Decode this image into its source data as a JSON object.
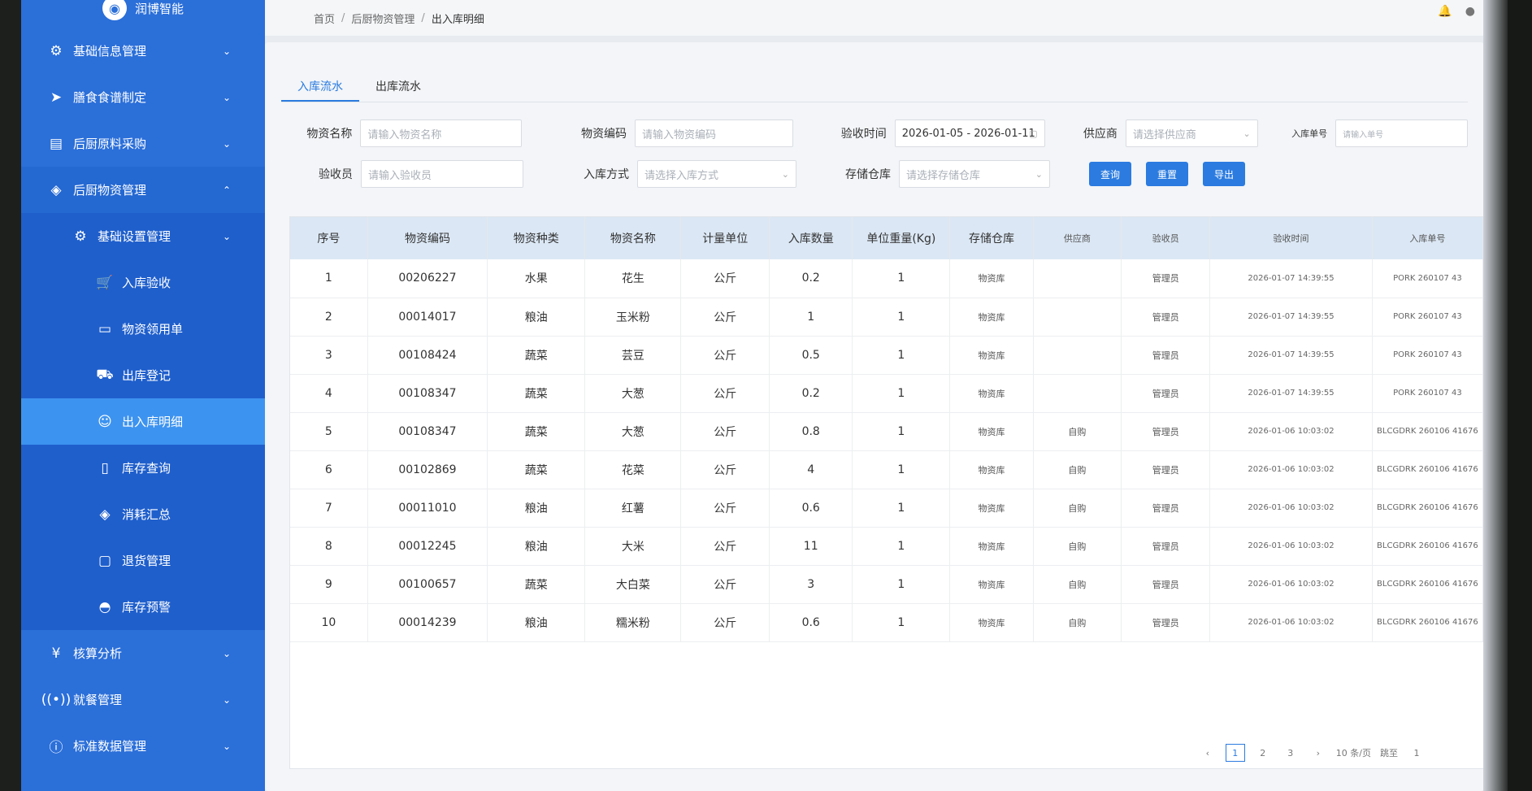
{
  "logo": {
    "text": "润博智能"
  },
  "sidebar": {
    "items": [
      {
        "label": "基础信息管理",
        "icon": "gear-icon"
      },
      {
        "label": "膳食食谱制定",
        "icon": "send-icon"
      },
      {
        "label": "后厨原料采购",
        "icon": "clipboard-icon"
      },
      {
        "label": "后厨物资管理",
        "icon": "layers-icon"
      }
    ],
    "sub": {
      "label": "基础设置管理"
    },
    "sub_items": [
      {
        "label": "入库验收",
        "icon": "cart-icon"
      },
      {
        "label": "物资领用单",
        "icon": "card-icon"
      },
      {
        "label": "出库登记",
        "icon": "truck-icon"
      },
      {
        "label": "出入库明细",
        "icon": "user-icon"
      },
      {
        "label": "库存查询",
        "icon": "document-icon"
      },
      {
        "label": "消耗汇总",
        "icon": "layers-icon"
      },
      {
        "label": "退货管理",
        "icon": "box-icon"
      },
      {
        "label": "库存预警",
        "icon": "eye-icon"
      }
    ],
    "bottom_items": [
      {
        "label": "核算分析",
        "icon": "yen-icon"
      },
      {
        "label": "就餐管理",
        "icon": "signal-icon"
      },
      {
        "label": "标准数据管理",
        "icon": "info-icon"
      }
    ]
  },
  "breadcrumb": {
    "home": "首页",
    "parent": "后厨物资管理",
    "current": "出入库明细"
  },
  "tabs": [
    "入库流水",
    "出库流水"
  ],
  "filters": {
    "name_label": "物资名称",
    "name_placeholder": "请输入物资名称",
    "code_label": "物资编码",
    "code_placeholder": "请输入物资编码",
    "time_label": "验收时间",
    "time_value": "2026-01-05 - 2026-01-11",
    "supplier_label": "供应商",
    "supplier_placeholder": "请选择供应商",
    "order_label": "入库单号",
    "order_placeholder": "请输入单号",
    "inspector_label": "验收员",
    "inspector_placeholder": "请输入验收员",
    "method_label": "入库方式",
    "method_placeholder": "请选择入库方式",
    "warehouse_label": "存储仓库",
    "warehouse_placeholder": "请选择存储仓库",
    "btn_query": "查询",
    "btn_reset": "重置",
    "btn_export": "导出"
  },
  "table": {
    "headers": [
      "序号",
      "物资编码",
      "物资种类",
      "物资名称",
      "计量单位",
      "入库数量",
      "单位重量(Kg)",
      "存储仓库",
      "供应商",
      "验收员",
      "验收时间",
      "入库单号"
    ],
    "rows": [
      [
        "1",
        "00206227",
        "水果",
        "花生",
        "公斤",
        "0.2",
        "1",
        "物资库",
        "",
        "管理员",
        "2026-01-07 14:39:55",
        "PORK 260107 43"
      ],
      [
        "2",
        "00014017",
        "粮油",
        "玉米粉",
        "公斤",
        "1",
        "1",
        "物资库",
        "",
        "管理员",
        "2026-01-07 14:39:55",
        "PORK 260107 43"
      ],
      [
        "3",
        "00108424",
        "蔬菜",
        "芸豆",
        "公斤",
        "0.5",
        "1",
        "物资库",
        "",
        "管理员",
        "2026-01-07 14:39:55",
        "PORK 260107 43"
      ],
      [
        "4",
        "00108347",
        "蔬菜",
        "大葱",
        "公斤",
        "0.2",
        "1",
        "物资库",
        "",
        "管理员",
        "2026-01-07 14:39:55",
        "PORK 260107 43"
      ],
      [
        "5",
        "00108347",
        "蔬菜",
        "大葱",
        "公斤",
        "0.8",
        "1",
        "物资库",
        "自购",
        "管理员",
        "2026-01-06 10:03:02",
        "BLCGDRK 260106 41676"
      ],
      [
        "6",
        "00102869",
        "蔬菜",
        "花菜",
        "公斤",
        "4",
        "1",
        "物资库",
        "自购",
        "管理员",
        "2026-01-06 10:03:02",
        "BLCGDRK 260106 41676"
      ],
      [
        "7",
        "00011010",
        "粮油",
        "红薯",
        "公斤",
        "0.6",
        "1",
        "物资库",
        "自购",
        "管理员",
        "2026-01-06 10:03:02",
        "BLCGDRK 260106 41676"
      ],
      [
        "8",
        "00012245",
        "粮油",
        "大米",
        "公斤",
        "11",
        "1",
        "物资库",
        "自购",
        "管理员",
        "2026-01-06 10:03:02",
        "BLCGDRK 260106 41676"
      ],
      [
        "9",
        "00100657",
        "蔬菜",
        "大白菜",
        "公斤",
        "3",
        "1",
        "物资库",
        "自购",
        "管理员",
        "2026-01-06 10:03:02",
        "BLCGDRK 260106 41676"
      ],
      [
        "10",
        "00014239",
        "粮油",
        "糯米粉",
        "公斤",
        "0.6",
        "1",
        "物资库",
        "自购",
        "管理员",
        "2026-01-06 10:03:02",
        "BLCGDRK 260106 41676"
      ]
    ]
  },
  "pager": {
    "prev": "‹",
    "p1": "1",
    "p2": "2",
    "p3": "3",
    "next": "›",
    "size": "10 条/页",
    "goto": "跳至",
    "goto_value": "1"
  },
  "colors": {
    "sidebar": "#2b6fd9",
    "active": "#3d93f0",
    "accent": "#2b7be0"
  }
}
